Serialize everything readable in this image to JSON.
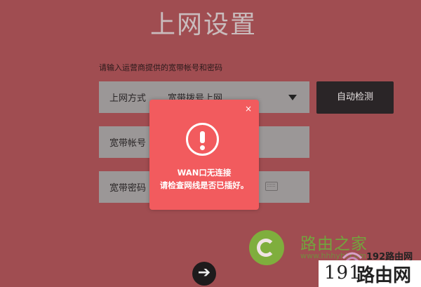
{
  "page": {
    "title": "上网设置",
    "hint": "请输入运营商提供的宽带帐号和密码"
  },
  "connection_type": {
    "label": "上网方式",
    "value": "宽带拨号上网",
    "detect_button": "自动检测"
  },
  "account": {
    "label": "宽带帐号"
  },
  "password": {
    "label": "宽带密码",
    "icon": "keyboard-icon"
  },
  "next_button": {
    "glyph": "➔",
    "icon": "arrow-right-icon"
  },
  "modal": {
    "close": "×",
    "icon": "alert-icon",
    "line1": "WAN口无连接",
    "line2": "请检查网线是否已插好。"
  },
  "watermark": {
    "brand_cn": "路由之家",
    "url": "www.hhhyhl.com",
    "corner_small": "192路由网",
    "corner_num": "191",
    "corner_cn": "路由网"
  },
  "colors": {
    "background": "#a04d51",
    "field": "#9b9797",
    "button_dark": "#2a2527",
    "modal": "#f25b5e"
  }
}
